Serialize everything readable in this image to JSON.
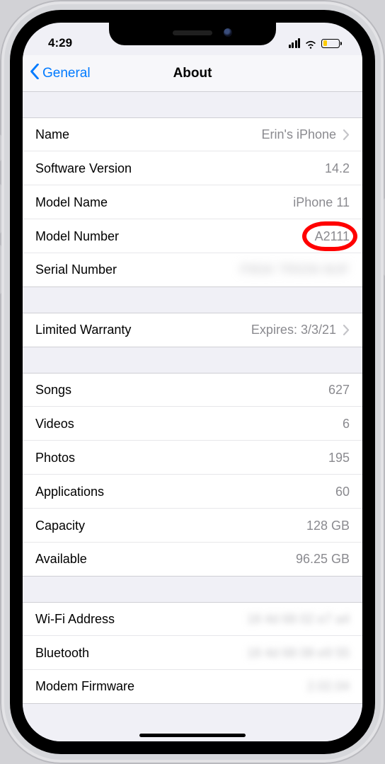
{
  "status": {
    "time": "4:29"
  },
  "nav": {
    "back": "General",
    "title": "About"
  },
  "sections": [
    {
      "rows": [
        {
          "label": "Name",
          "value": "Erin's iPhone",
          "chevron": true
        },
        {
          "label": "Software Version",
          "value": "14.2"
        },
        {
          "label": "Model Name",
          "value": "iPhone 11"
        },
        {
          "label": "Model Number",
          "value": "A2111",
          "highlight": true
        },
        {
          "label": "Serial Number",
          "value": "F9GK TRION MJF",
          "obscured": true
        }
      ]
    },
    {
      "rows": [
        {
          "label": "Limited Warranty",
          "value": "Expires: 3/3/21",
          "chevron": true
        }
      ]
    },
    {
      "rows": [
        {
          "label": "Songs",
          "value": "627"
        },
        {
          "label": "Videos",
          "value": "6"
        },
        {
          "label": "Photos",
          "value": "195"
        },
        {
          "label": "Applications",
          "value": "60"
        },
        {
          "label": "Capacity",
          "value": "128 GB"
        },
        {
          "label": "Available",
          "value": "96.25 GB"
        }
      ]
    },
    {
      "rows": [
        {
          "label": "Wi-Fi Address",
          "value": "18 4d 68 02 e7 a4",
          "obscured": true
        },
        {
          "label": "Bluetooth",
          "value": "18 4d 68 08 e9 55",
          "obscured": true
        },
        {
          "label": "Modem Firmware",
          "value": "2.02.04",
          "obscured": true
        }
      ]
    }
  ]
}
